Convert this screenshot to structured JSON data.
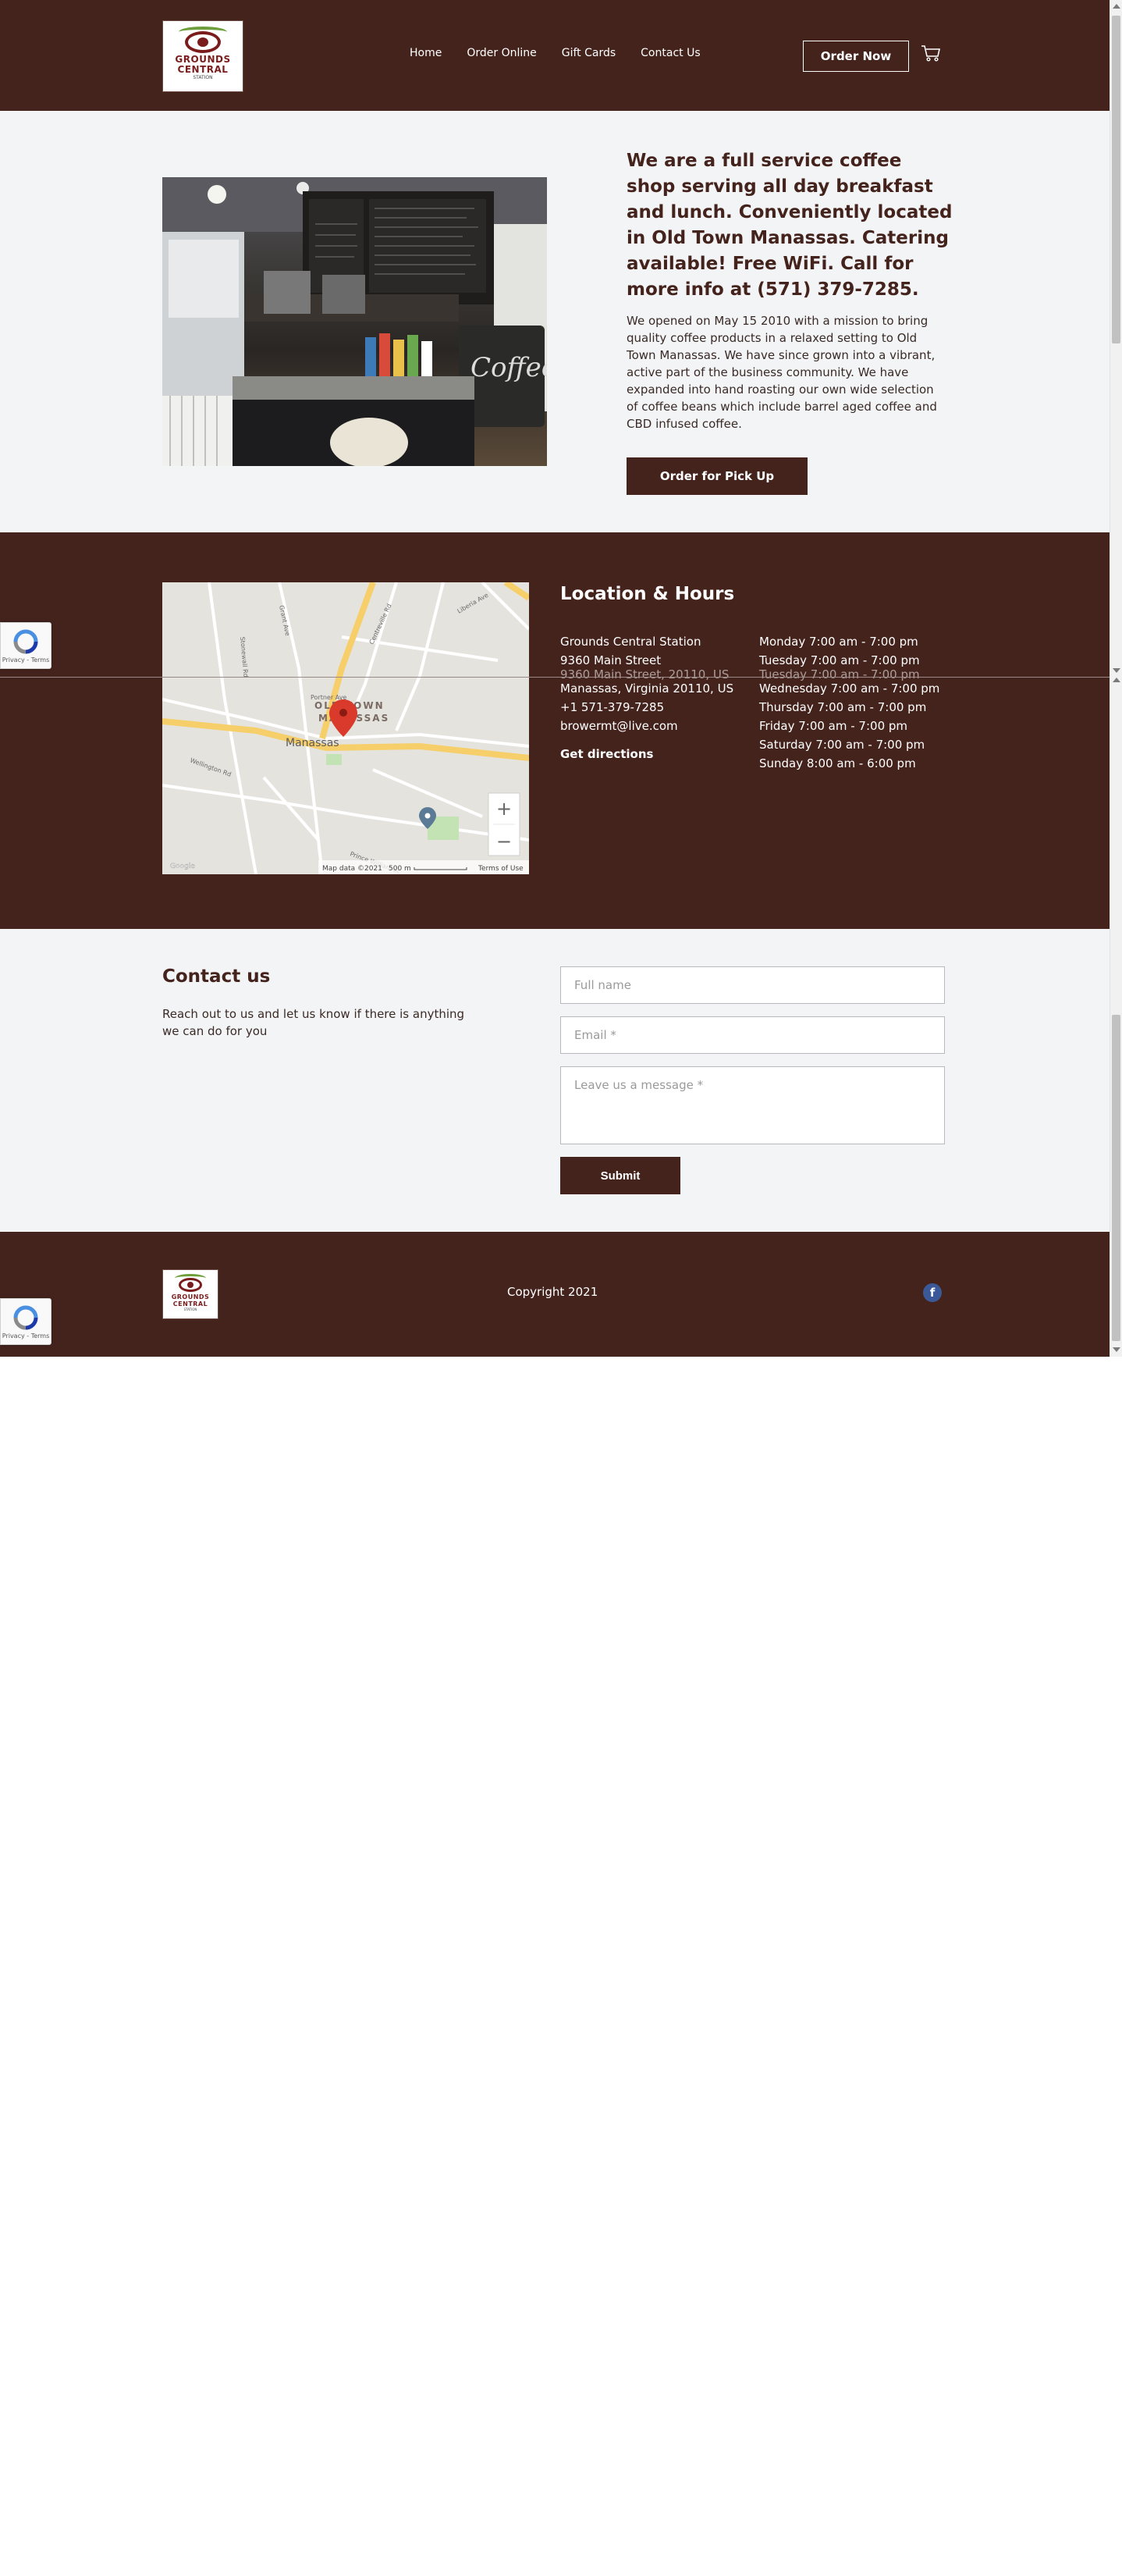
{
  "header": {
    "logo": {
      "line1": "GROUNDS",
      "line2": "CENTRAL",
      "line3": "STATION",
      "icon": "grounds-central-logo"
    },
    "nav": [
      {
        "label": "Home"
      },
      {
        "label": "Order Online"
      },
      {
        "label": "Gift Cards"
      },
      {
        "label": "Contact Us"
      }
    ],
    "order_now": "Order Now",
    "cart_icon": "shopping-cart-icon"
  },
  "about": {
    "title": "We are a full service coffee shop serving all day breakfast and lunch. Conveniently located in Old Town Manassas. Catering available! Free WiFi. Call for more info at (571) 379-7285.",
    "text": "We opened on May 15 2010 with a mission to bring quality coffee products in a relaxed setting to Old Town Manassas. We have since grown into a vibrant, active part of the business community. We have expanded into hand roasting our own wide selection of coffee beans which include barrel aged coffee and CBD infused coffee.",
    "pickup_button": "Order for Pick Up",
    "photo": {
      "menu_board_word": "Coffee"
    }
  },
  "location": {
    "title": "Location & Hours",
    "address": [
      "Grounds Central Station",
      "9360 Main Street",
      "9360 Main Street, 20110, US",
      "Manassas, Virginia 20110, US",
      "+1 571-379-7285",
      "browermt@live.com"
    ],
    "directions": "Get directions",
    "hours": [
      "Monday 7:00 am - 7:00 pm",
      "Tuesday 7:00 am - 7:00 pm",
      "Tuesday 7:00 am - 7:00 pm",
      "Wednesday 7:00 am - 7:00 pm",
      "Thursday 7:00 am - 7:00 pm",
      "Friday 7:00 am - 7:00 pm",
      "Saturday 7:00 am - 7:00 pm",
      "Sunday 8:00 am - 6:00 pm"
    ],
    "map": {
      "area_label_1": "OLD TOWN",
      "area_label_2": "MANASSAS",
      "city_label": "Manassas",
      "streets": [
        "Prince William St",
        "Grant Ave",
        "Wellington Rd",
        "Centreville Rd",
        "Portner Ave",
        "Sudley Rd",
        "Liberia Ave",
        "Stonewall Rd",
        "Quarry St"
      ],
      "zoom_in": "+",
      "zoom_out": "−",
      "attribution": "Map data ©2021",
      "scale": "500 m",
      "terms": "Terms of Use",
      "brand": "Google"
    }
  },
  "contact": {
    "title": "Contact us",
    "text": "Reach out to us and let us know if there is anything we can do for you",
    "name_placeholder": "Full name",
    "email_placeholder": "Email *",
    "message_placeholder": "Leave us a message *",
    "submit": "Submit"
  },
  "footer": {
    "copyright": "Copyright 2021",
    "facebook": "f",
    "facebook_icon": "facebook-icon"
  },
  "recaptcha": {
    "text": "Privacy - Terms",
    "icon": "recaptcha-icon"
  },
  "colors": {
    "brand": "#45231d",
    "background_light": "#f3f4f6",
    "facebook": "#3b5998"
  }
}
